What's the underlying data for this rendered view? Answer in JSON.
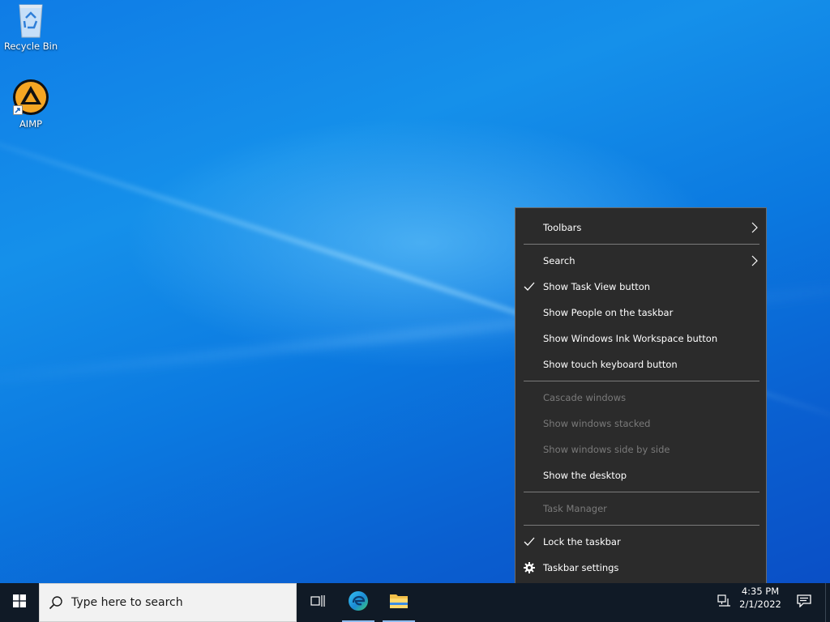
{
  "desktop": {
    "icons": [
      {
        "label": "Recycle Bin",
        "icon": "recycle-bin-icon"
      },
      {
        "label": "AIMP",
        "icon": "aimp-icon"
      }
    ]
  },
  "context_menu": {
    "items": [
      {
        "label": "Toolbars",
        "submenu": true,
        "checked": false,
        "enabled": true
      },
      {
        "label": "Search",
        "submenu": true,
        "checked": false,
        "enabled": true
      },
      {
        "label": "Show Task View button",
        "submenu": false,
        "checked": true,
        "enabled": true
      },
      {
        "label": "Show People on the taskbar",
        "submenu": false,
        "checked": false,
        "enabled": true
      },
      {
        "label": "Show Windows Ink Workspace button",
        "submenu": false,
        "checked": false,
        "enabled": true
      },
      {
        "label": "Show touch keyboard button",
        "submenu": false,
        "checked": false,
        "enabled": true
      },
      {
        "label": "Cascade windows",
        "submenu": false,
        "checked": false,
        "enabled": false
      },
      {
        "label": "Show windows stacked",
        "submenu": false,
        "checked": false,
        "enabled": false
      },
      {
        "label": "Show windows side by side",
        "submenu": false,
        "checked": false,
        "enabled": false
      },
      {
        "label": "Show the desktop",
        "submenu": false,
        "checked": false,
        "enabled": true
      },
      {
        "label": "Task Manager",
        "submenu": false,
        "checked": false,
        "enabled": false
      },
      {
        "label": "Lock the taskbar",
        "submenu": false,
        "checked": true,
        "enabled": true
      },
      {
        "label": "Taskbar settings",
        "submenu": false,
        "checked": false,
        "enabled": true,
        "icon": "gear-icon"
      }
    ]
  },
  "taskbar": {
    "search_placeholder": "Type here to search",
    "clock_time": "4:35 PM",
    "clock_date": "2/1/2022",
    "pinned": [
      {
        "icon": "task-view-icon"
      },
      {
        "icon": "edge-icon"
      },
      {
        "icon": "file-explorer-icon"
      }
    ]
  },
  "colors": {
    "menu_bg": "#2b2b2b",
    "menu_disabled_text": "#7a7a7a",
    "taskbar_bg": "#101a26",
    "desktop_blue": "#0b79e0"
  }
}
